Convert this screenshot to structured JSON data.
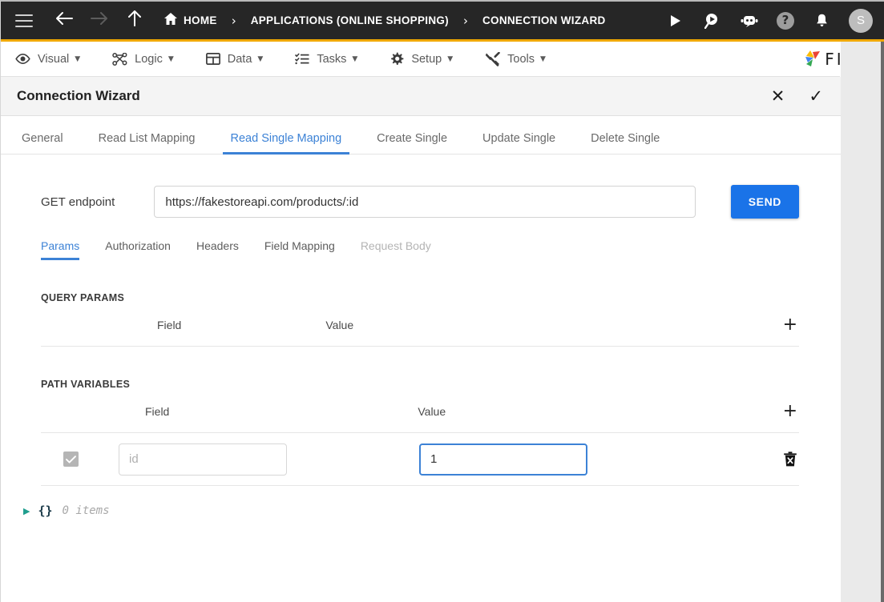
{
  "topbar": {
    "menu_icon": "hamburger-icon",
    "back_icon": "arrow-left-icon",
    "forward_icon": "arrow-right-icon",
    "up_icon": "arrow-up-icon",
    "home_icon": "home-icon",
    "breadcrumbs": [
      {
        "label": "HOME"
      },
      {
        "label": "APPLICATIONS (ONLINE SHOPPING)"
      },
      {
        "label": "CONNECTION WIZARD"
      }
    ],
    "separator": "›",
    "actions": [
      {
        "name": "run-icon",
        "glyph": "▶"
      },
      {
        "name": "search-play-icon",
        "glyph": "▶"
      },
      {
        "name": "chatbot-icon",
        "glyph": "●"
      },
      {
        "name": "help-icon",
        "glyph": "?"
      },
      {
        "name": "notifications-icon",
        "glyph": "🔔"
      }
    ],
    "avatar_initial": "S",
    "accent_color": "#f0a800",
    "background": "#262626"
  },
  "menubar": {
    "items": [
      {
        "label": "Visual",
        "icon": "eye-icon",
        "glyph": "👁"
      },
      {
        "label": "Logic",
        "icon": "logic-nodes-icon",
        "glyph": "∴"
      },
      {
        "label": "Data",
        "icon": "table-icon",
        "glyph": "▦"
      },
      {
        "label": "Tasks",
        "icon": "tasks-list-icon",
        "glyph": "≣"
      },
      {
        "label": "Setup",
        "icon": "gear-icon",
        "glyph": "⚙"
      },
      {
        "label": "Tools",
        "icon": "tools-icon",
        "glyph": "⚒"
      }
    ],
    "caret": "▼",
    "brand": "FIVE"
  },
  "dialog": {
    "title": "Connection Wizard",
    "close_label": "✕",
    "confirm_label": "✓"
  },
  "main_tabs": [
    {
      "label": "General",
      "active": false
    },
    {
      "label": "Read List Mapping",
      "active": false
    },
    {
      "label": "Read Single Mapping",
      "active": true
    },
    {
      "label": "Create Single",
      "active": false
    },
    {
      "label": "Update Single",
      "active": false
    },
    {
      "label": "Delete Single",
      "active": false
    }
  ],
  "endpoint": {
    "label": "GET endpoint",
    "url_value": "https://fakestoreapi.com/products/:id",
    "url_placeholder": "",
    "send_label": "SEND",
    "send_color": "#1a73e8"
  },
  "sub_tabs": [
    {
      "label": "Params",
      "active": true,
      "disabled": false
    },
    {
      "label": "Authorization",
      "active": false,
      "disabled": false
    },
    {
      "label": "Headers",
      "active": false,
      "disabled": false
    },
    {
      "label": "Field Mapping",
      "active": false,
      "disabled": false
    },
    {
      "label": "Request Body",
      "active": false,
      "disabled": true
    }
  ],
  "query_params": {
    "section_title": "QUERY PARAMS",
    "col_field": "Field",
    "col_value": "Value",
    "add_label": "+",
    "rows": []
  },
  "path_variables": {
    "section_title": "PATH VARIABLES",
    "col_field": "Field",
    "col_value": "Value",
    "add_label": "+",
    "rows": [
      {
        "enabled": true,
        "field_value": "",
        "field_placeholder": "id",
        "value_value": "1",
        "value_focused": true,
        "delete_icon": "trash-icon"
      }
    ]
  },
  "response_viewer": {
    "expander": "▶",
    "braces": "{}",
    "summary": "0 items"
  }
}
